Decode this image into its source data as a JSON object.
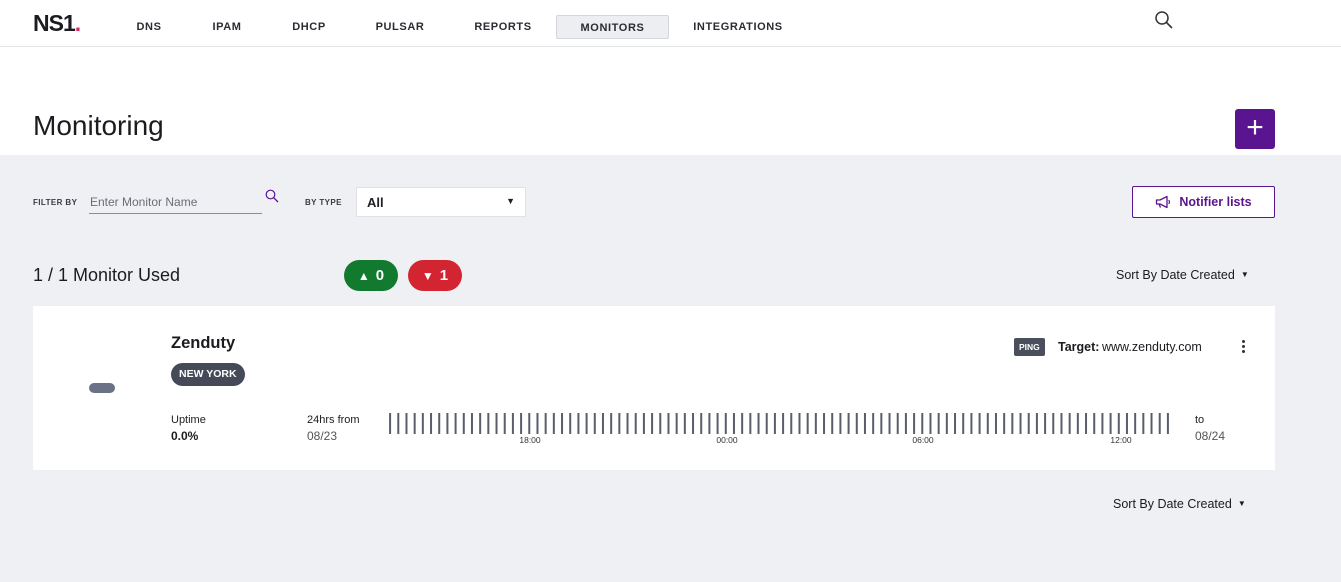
{
  "nav": {
    "logo": "NS1",
    "logo_dot": ".",
    "tabs": [
      "DNS",
      "IPAM",
      "DHCP",
      "PULSAR",
      "REPORTS",
      "MONITORS",
      "INTEGRATIONS"
    ],
    "active_tab": "MONITORS"
  },
  "header": {
    "title": "Monitoring",
    "add_label": "+"
  },
  "filters": {
    "filter_by_label": "FILTER BY",
    "name_placeholder": "Enter Monitor Name",
    "by_type_label": "BY TYPE",
    "type_value": "All",
    "notifier_label": "Notifier lists"
  },
  "summary": {
    "used_text": "1 / 1 Monitor Used",
    "up_count": "0",
    "down_count": "1",
    "sort_label": "Sort By Date Created"
  },
  "monitor": {
    "name": "Zenduty",
    "region": "NEW YORK",
    "type": "PING",
    "target_label": "Target:",
    "target_value": "www.zenduty.com",
    "uptime_label": "Uptime",
    "uptime_value": "0.0%",
    "from_label": "24hrs from",
    "from_date": "08/23",
    "to_label": "to",
    "to_date": "08/24",
    "bar_count": 96,
    "time_ticks": [
      "18:00",
      "00:00",
      "06:00",
      "12:00"
    ]
  },
  "footer": {
    "sort_label": "Sort By Date Created"
  },
  "colors": {
    "brand": "#5b1490",
    "up": "#127a2e",
    "down": "#d32531",
    "bar": "#5a5e6a"
  }
}
